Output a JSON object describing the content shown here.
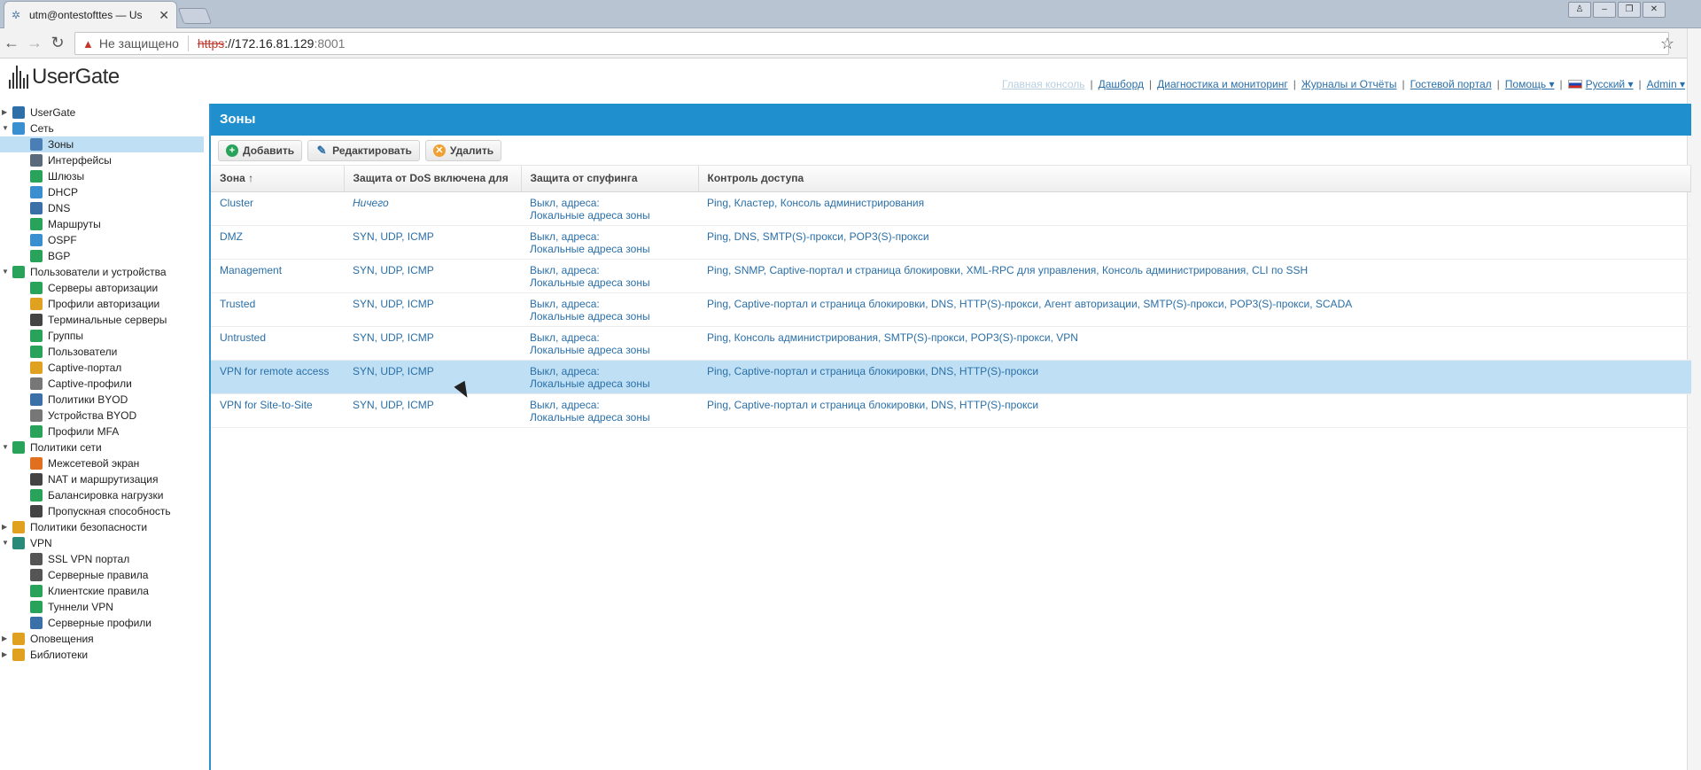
{
  "browser": {
    "tab_title": "utm@ontestofttes — Us",
    "address": {
      "insecure_label": "Не защищено",
      "scheme": "https",
      "host": "://172.16.81.129",
      "port": ":8001"
    }
  },
  "app": {
    "logo_text": "UserGate"
  },
  "topnav": {
    "items": [
      {
        "label": "Главная консоль",
        "disabled": true
      },
      {
        "label": "Дашборд"
      },
      {
        "label": "Диагностика и мониторинг"
      },
      {
        "label": "Журналы и Отчёты"
      },
      {
        "label": "Гостевой портал"
      },
      {
        "label": "Помощь ▾"
      },
      {
        "label": "Русский ▾"
      },
      {
        "label": "Admin ▾"
      }
    ]
  },
  "sidebar": {
    "items": [
      {
        "label": "UserGate",
        "level": 0,
        "expand": "▶",
        "color": "#2f6fa8"
      },
      {
        "label": "Сеть",
        "level": 0,
        "expand": "▼",
        "color": "#3a8fd0"
      },
      {
        "label": "Зоны",
        "level": 1,
        "selected": true,
        "color": "#4a7fb5"
      },
      {
        "label": "Интерфейсы",
        "level": 1,
        "color": "#5a6a7a"
      },
      {
        "label": "Шлюзы",
        "level": 1,
        "color": "#2aa35a"
      },
      {
        "label": "DHCP",
        "level": 1,
        "color": "#3a8fd0"
      },
      {
        "label": "DNS",
        "level": 1,
        "color": "#3a6fa8"
      },
      {
        "label": "Маршруты",
        "level": 1,
        "color": "#2aa35a"
      },
      {
        "label": "OSPF",
        "level": 1,
        "color": "#3a8fd0"
      },
      {
        "label": "BGP",
        "level": 1,
        "color": "#2aa35a"
      },
      {
        "label": "Пользователи и устройства",
        "level": 0,
        "expand": "▼",
        "color": "#2aa35a"
      },
      {
        "label": "Серверы авторизации",
        "level": 1,
        "color": "#2aa35a"
      },
      {
        "label": "Профили авторизации",
        "level": 1,
        "color": "#e0a020"
      },
      {
        "label": "Терминальные серверы",
        "level": 1,
        "color": "#444"
      },
      {
        "label": "Группы",
        "level": 1,
        "color": "#2aa35a"
      },
      {
        "label": "Пользователи",
        "level": 1,
        "color": "#2aa35a"
      },
      {
        "label": "Captive-портал",
        "level": 1,
        "color": "#e0a020"
      },
      {
        "label": "Captive-профили",
        "level": 1,
        "color": "#777"
      },
      {
        "label": "Политики BYOD",
        "level": 1,
        "color": "#3a6fa8"
      },
      {
        "label": "Устройства BYOD",
        "level": 1,
        "color": "#777"
      },
      {
        "label": "Профили MFA",
        "level": 1,
        "color": "#2aa35a"
      },
      {
        "label": "Политики сети",
        "level": 0,
        "expand": "▼",
        "color": "#2aa35a"
      },
      {
        "label": "Межсетевой экран",
        "level": 1,
        "color": "#e07020"
      },
      {
        "label": "NAT и маршрутизация",
        "level": 1,
        "color": "#444"
      },
      {
        "label": "Балансировка нагрузки",
        "level": 1,
        "color": "#2aa35a"
      },
      {
        "label": "Пропускная способность",
        "level": 1,
        "color": "#444"
      },
      {
        "label": "Политики безопасности",
        "level": 0,
        "expand": "▶",
        "color": "#e0a020"
      },
      {
        "label": "VPN",
        "level": 0,
        "expand": "▼",
        "color": "#2a8a7a"
      },
      {
        "label": "SSL VPN портал",
        "level": 1,
        "color": "#555"
      },
      {
        "label": "Серверные правила",
        "level": 1,
        "color": "#555"
      },
      {
        "label": "Клиентские правила",
        "level": 1,
        "color": "#2aa35a"
      },
      {
        "label": "Туннели VPN",
        "level": 1,
        "color": "#2aa35a"
      },
      {
        "label": "Серверные профили",
        "level": 1,
        "color": "#3a6fa8"
      },
      {
        "label": "Оповещения",
        "level": 0,
        "expand": "▶",
        "color": "#e0a020"
      },
      {
        "label": "Библиотеки",
        "level": 0,
        "expand": "▶",
        "color": "#e0a020"
      }
    ]
  },
  "main": {
    "title": "Зоны",
    "actions": {
      "add": "Добавить",
      "edit": "Редактировать",
      "delete": "Удалить"
    },
    "columns": [
      "Зона ↑",
      "Защита от DoS включена для",
      "Защита от спуфинга",
      "Контроль доступа"
    ],
    "rows": [
      {
        "zone": "Cluster",
        "dos": "Ничего",
        "dos_italic": true,
        "spoof1": "Выкл, адреса:",
        "spoof2": "Локальные адреса зоны",
        "access": "Ping, Кластер, Консоль администрирования"
      },
      {
        "zone": "DMZ",
        "dos": "SYN, UDP, ICMP",
        "spoof1": "Выкл, адреса:",
        "spoof2": "Локальные адреса зоны",
        "access": "Ping, DNS, SMTP(S)-прокси, POP3(S)-прокси"
      },
      {
        "zone": "Management",
        "dos": "SYN, UDP, ICMP",
        "spoof1": "Выкл, адреса:",
        "spoof2": "Локальные адреса зоны",
        "access": "Ping, SNMP, Captive-портал и страница блокировки, XML-RPC для управления, Консоль администрирования, CLI по SSH"
      },
      {
        "zone": "Trusted",
        "dos": "SYN, UDP, ICMP",
        "spoof1": "Выкл, адреса:",
        "spoof2": "Локальные адреса зоны",
        "access": "Ping, Captive-портал и страница блокировки, DNS, HTTP(S)-прокси, Агент авторизации, SMTP(S)-прокси, POP3(S)-прокси, SCADA"
      },
      {
        "zone": "Untrusted",
        "dos": "SYN, UDP, ICMP",
        "spoof1": "Выкл, адреса:",
        "spoof2": "Локальные адреса зоны",
        "access": "Ping, Консоль администрирования, SMTP(S)-прокси, POP3(S)-прокси, VPN"
      },
      {
        "zone": "VPN for remote access",
        "dos": "SYN, UDP, ICMP",
        "spoof1": "Выкл, адреса:",
        "spoof2": "Локальные адреса зоны",
        "access": "Ping, Captive-портал и страница блокировки, DNS, HTTP(S)-прокси",
        "selected": true
      },
      {
        "zone": "VPN for Site-to-Site",
        "dos": "SYN, UDP, ICMP",
        "spoof1": "Выкл, адреса:",
        "spoof2": "Локальные адреса зоны",
        "access": "Ping, Captive-портал и страница блокировки, DNS, HTTP(S)-прокси"
      }
    ]
  },
  "colors": {
    "accent": "#1f8fce",
    "selection": "#bfe0f4",
    "link": "#2a6fa8"
  }
}
